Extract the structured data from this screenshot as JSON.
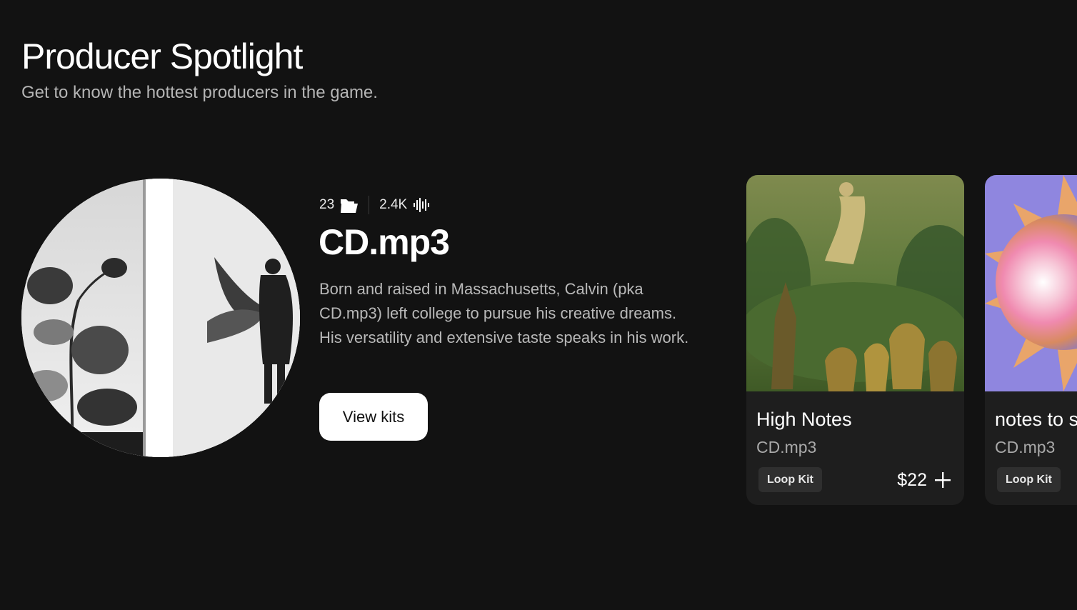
{
  "section": {
    "title": "Producer Spotlight",
    "subtitle": "Get to know the hottest producers in the game."
  },
  "producer": {
    "name": "CD.mp3",
    "kits_count": "23",
    "kits_icon": "folder-icon",
    "plays_count": "2.4K",
    "plays_icon": "waveform-icon",
    "bio": "Born and raised in Massachusetts, Calvin (pka CD.mp3) left college to pursue his creative dreams. His versatility and extensive taste speaks in his work.",
    "cta_label": "View kits"
  },
  "kits": [
    {
      "title": "High Notes",
      "author": "CD.mp3",
      "tag": "Loop Kit",
      "price": "$22",
      "add_icon": "plus-icon"
    },
    {
      "title": "notes to s",
      "author": "CD.mp3",
      "tag": "Loop Kit"
    }
  ],
  "colors": {
    "background": "#121212",
    "card": "#1e1e1e",
    "tag": "#2f2f2f",
    "text_primary": "#ffffff",
    "text_secondary": "#b5b5b5"
  }
}
